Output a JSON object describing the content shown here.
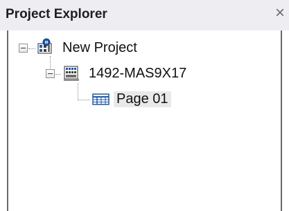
{
  "panel": {
    "title": "Project Explorer",
    "close_glyph": "×"
  },
  "tree": {
    "project": {
      "label": "New Project",
      "icon": "project-icon",
      "expanded": true
    },
    "device": {
      "label": "1492-MAS9X17",
      "icon": "device-icon",
      "expanded": true
    },
    "page": {
      "label": "Page 01",
      "icon": "page-icon",
      "selected": true
    }
  },
  "colors": {
    "title_bg": "#eeeef2",
    "panel_border": "#6a6a6a",
    "icon_blue": "#1f5aa5",
    "selection_bg": "#e9e9e9"
  }
}
